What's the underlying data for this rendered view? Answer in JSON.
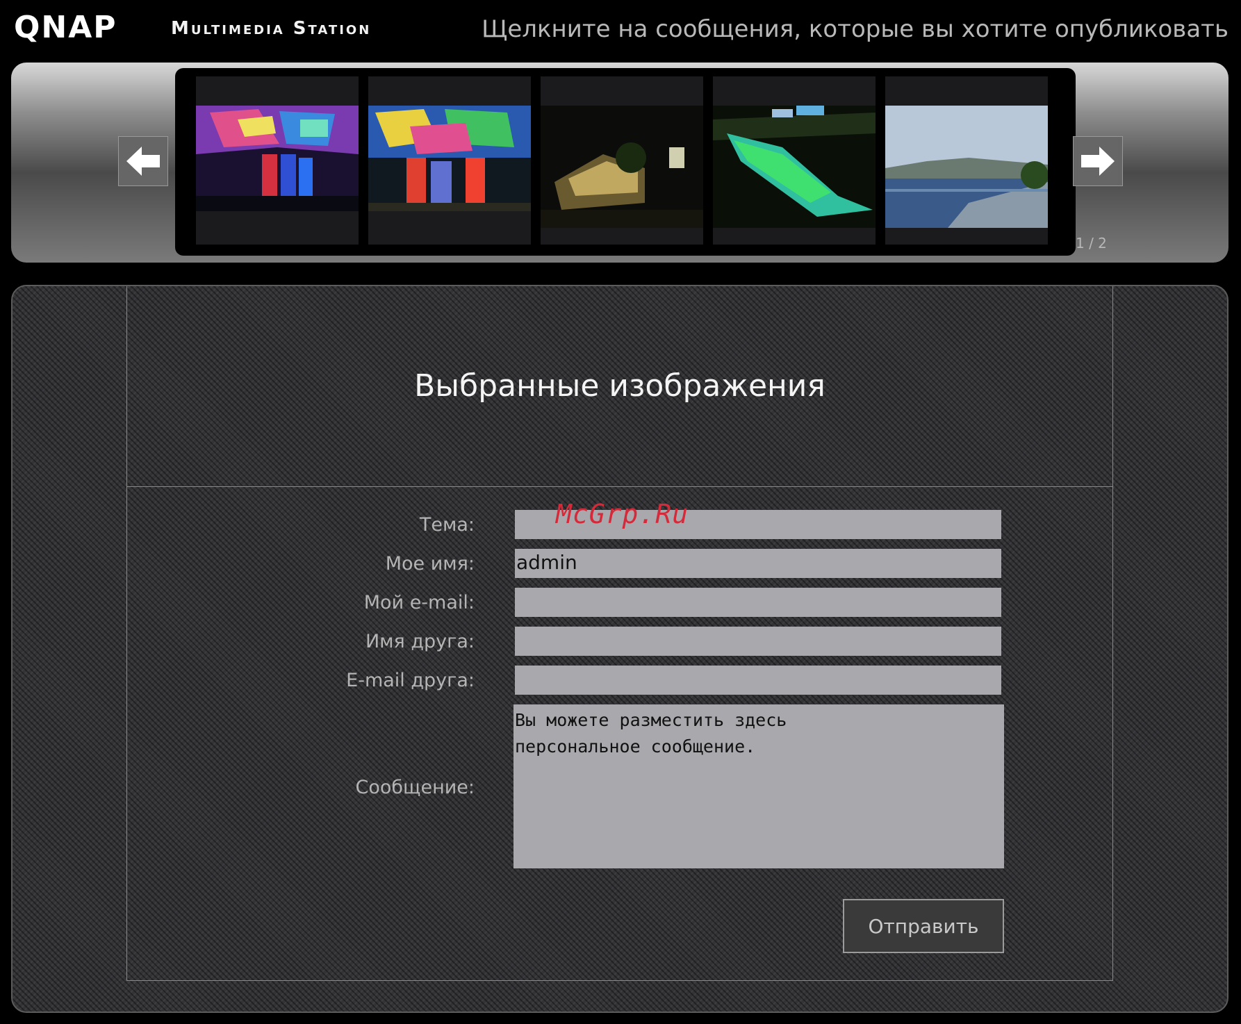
{
  "header": {
    "logo": "QNAP",
    "product": "Multimedia Station",
    "hint": "Щелкните на сообщения, которые вы хотите опубликовать"
  },
  "filmstrip": {
    "prev_icon": "arrow-left-icon",
    "next_icon": "arrow-right-icon",
    "pager": "1 / 2",
    "thumbnails": [
      {
        "alt": "thumbnail-1"
      },
      {
        "alt": "thumbnail-2"
      },
      {
        "alt": "thumbnail-3"
      },
      {
        "alt": "thumbnail-4"
      },
      {
        "alt": "thumbnail-5"
      }
    ]
  },
  "form": {
    "title": "Выбранные изображения",
    "subject_label": "Тема:",
    "subject_value": "",
    "name_label": "Мое имя:",
    "name_value": "admin",
    "email_label": "Мой e-mail:",
    "email_value": "",
    "friend_name_label": "Имя друга:",
    "friend_name_value": "",
    "friend_email_label": "E-mail друга:",
    "friend_email_value": "",
    "message_label": "Сообщение:",
    "message_value": "Вы можете разместить здесь\nперсональное сообщение.",
    "send_label": "Отправить"
  },
  "watermark": "McGrp.Ru"
}
